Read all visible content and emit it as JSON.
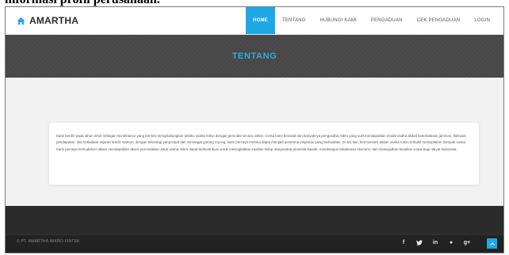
{
  "caption": "informasi profil perusahaan.",
  "brand": {
    "name": "AMARTHA",
    "icon": "home-icon",
    "accent": "#1fa8e6"
  },
  "nav": {
    "items": [
      {
        "label": "HOME",
        "active": true
      },
      {
        "label": "TENTANG",
        "active": false
      },
      {
        "label": "HUBUNGI KAMI",
        "active": false
      },
      {
        "label": "PENGADUAN",
        "active": false
      },
      {
        "label": "CEK PENGADUAN",
        "active": false
      },
      {
        "label": "LOGIN",
        "active": false
      }
    ]
  },
  "page": {
    "title": "TENTANG",
    "title_color": "#2fa9e1"
  },
  "about": {
    "text": "Kami berdiri pada tahun 2010 sebagai microfinance yang bermisi menghubungkan pelaku usaha mikro dengan pemodal secara online. Cerita kami berawal dari banyaknya pengusaha mikro yang sulit mendapatkan modal usaha akibat keterbatasan jaminan, fluktuasi pendapatan, dan ketiadaan sejarah kredit. Namun, dengan teknologi yang tepat dan semangat gotong royong, kami percaya mereka dapat menjadi penerima pinjaman yang berkualitas. Di sisi lain, berinvestasi dalam usaha mikro terbukti menciptakan dampak sosial. Kami percaya kemudahan dalam mendapatkan akses permodalan untuk usaha mikro dapat berkontribusi untuk meningkatkan kualitas hidup masyarakat piramida bawah, membangun ketahanan ekonomi, dan mewujudkan keadilan sosial bagi rakyat Indonesia."
  },
  "footer": {
    "copyright": "© PT. AMARTHA MIKRO FINTEK",
    "socials": [
      {
        "icon": "facebook-icon",
        "glyph": "f"
      },
      {
        "icon": "twitter-icon",
        "glyph": "♥"
      },
      {
        "icon": "linkedin-icon",
        "glyph": "in"
      },
      {
        "icon": "dribbble-icon",
        "glyph": "●"
      },
      {
        "icon": "google-plus-icon",
        "glyph": "g+"
      }
    ],
    "to_top_icon": "chevron-up-icon"
  }
}
